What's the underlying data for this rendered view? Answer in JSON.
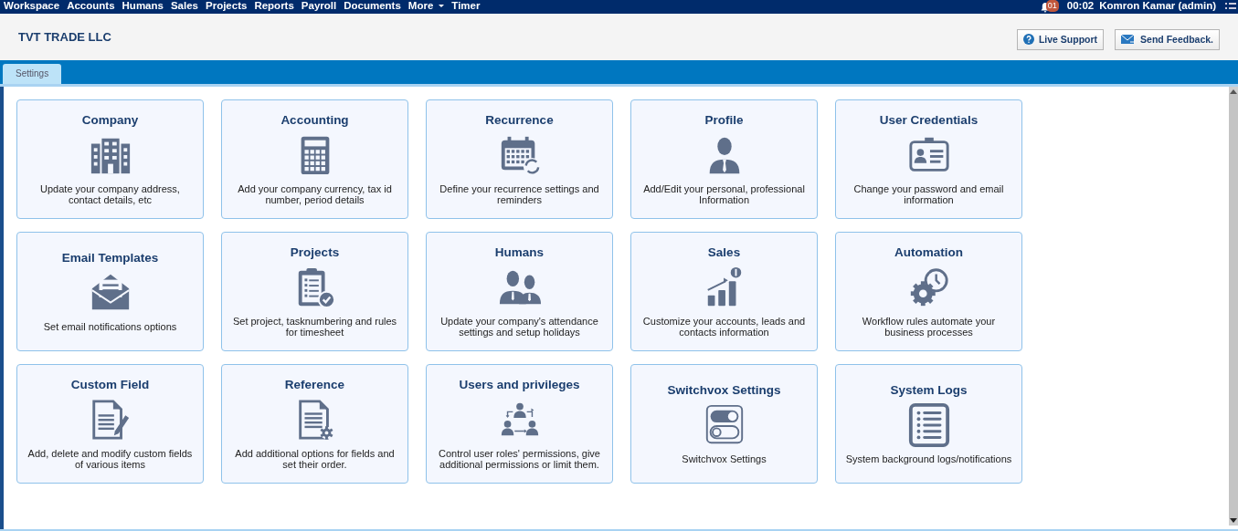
{
  "nav": {
    "items": [
      {
        "label": "Workspace",
        "dropdown": false
      },
      {
        "label": "Accounts",
        "dropdown": false
      },
      {
        "label": "Humans",
        "dropdown": false
      },
      {
        "label": "Sales",
        "dropdown": false
      },
      {
        "label": "Projects",
        "dropdown": false
      },
      {
        "label": "Reports",
        "dropdown": false
      },
      {
        "label": "Payroll",
        "dropdown": false
      },
      {
        "label": "Documents",
        "dropdown": false
      },
      {
        "label": "More",
        "dropdown": true
      },
      {
        "label": "Timer",
        "dropdown": false
      }
    ],
    "notifications": "01",
    "timer": "00:02",
    "user": "Komron Kamar (admin)"
  },
  "header": {
    "company": "TVT TRADE LLC",
    "buttons": [
      "Live Support",
      "Send Feedback."
    ]
  },
  "tabs": [
    {
      "label": "Settings",
      "selected": true
    }
  ],
  "cards": [
    {
      "title": "Company",
      "description": "Update your company address, contact details, etc"
    },
    {
      "title": "Accounting",
      "description": "Add your company currency, tax id number, period details"
    },
    {
      "title": "Recurrence",
      "description": "Define your recurrence settings and reminders"
    },
    {
      "title": "Profile",
      "description": "Add/Edit your personal, professional Information"
    },
    {
      "title": "User Credentials",
      "description": "Change your password and email information"
    },
    {
      "title": "Email Templates",
      "description": "Set email notifications options"
    },
    {
      "title": "Projects",
      "description": "Set project, tasknumbering and rules for timesheet"
    },
    {
      "title": "Humans",
      "description": "Update your company's attendance settings and setup holidays"
    },
    {
      "title": "Sales",
      "description": "Customize your accounts, leads and contacts information"
    },
    {
      "title": "Automation",
      "description": "Workflow rules automate your business processes"
    },
    {
      "title": "Custom Field",
      "description": "Add, delete and modify custom fields of various items"
    },
    {
      "title": "Reference",
      "description": "Add additional options for fields and set their order."
    },
    {
      "title": "Users and privileges",
      "description": "Control user roles' permissions, give additional permissions or limit them."
    },
    {
      "title": "Switchvox Settings",
      "description": "Switchvox Settings"
    },
    {
      "title": "System Logs",
      "description": "System background logs/notifications"
    }
  ]
}
